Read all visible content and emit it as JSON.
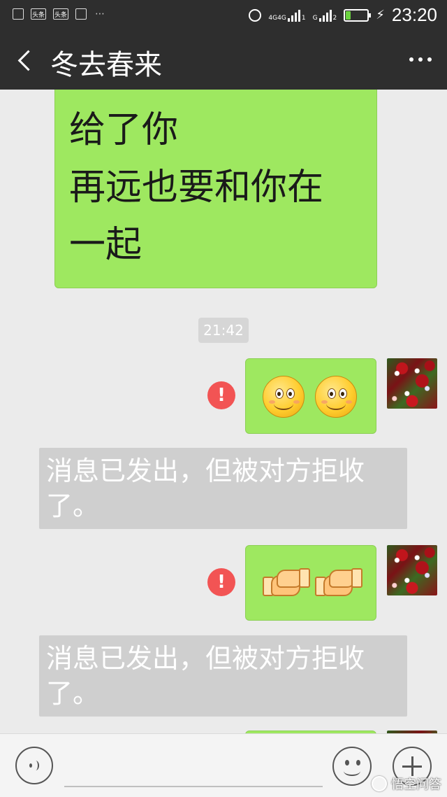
{
  "status_bar": {
    "left_icons": [
      "gallery-icon",
      "toutiao-icon",
      "toutiao-icon",
      "mail-icon"
    ],
    "left_icon_labels": [
      "头条",
      "头条"
    ],
    "network_labels": [
      "4G",
      "4G",
      "G"
    ],
    "sim_labels": [
      "1",
      "2"
    ],
    "battery_level": 0.2,
    "battery_color": "#6bd43f",
    "time": "23:20"
  },
  "header": {
    "title": "冬去春来",
    "background": "#2e2e2e"
  },
  "messages": {
    "first_bubble_text": "我把我的真爱留\n给了你\n再远也要和你在\n一起",
    "timestamp": "21:42",
    "error_symbol": "!",
    "notice_1": "消息已发出，但被对方拒收了。",
    "notice_2": "消息已发出，但被对方拒收了。"
  },
  "colors": {
    "bubble_green": "#9ee860",
    "error_red": "#f25454",
    "notice_gray": "#cfcfcf",
    "chat_bg": "#ebebeb"
  },
  "watermark": {
    "text": "悟空问答"
  }
}
